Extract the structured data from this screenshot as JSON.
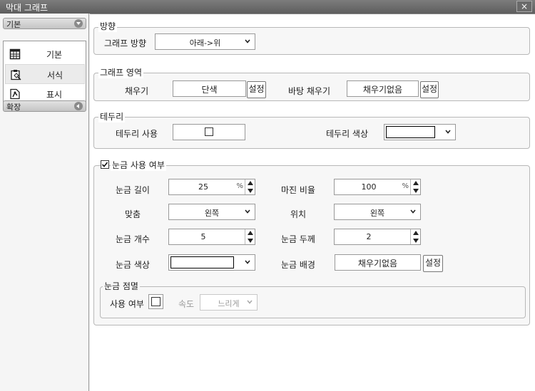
{
  "window": {
    "title": "막대 그래프",
    "close_glyph": "×"
  },
  "sidebar": {
    "basic_section": "기본",
    "extend_section": "확장",
    "items": [
      {
        "label": "기본",
        "icon": "table-icon"
      },
      {
        "label": "서식",
        "icon": "format-icon"
      },
      {
        "label": "표시",
        "icon": "display-icon"
      }
    ],
    "selected": "서식"
  },
  "direction": {
    "title": "방향",
    "label": "그래프 방향",
    "value": "아래->위"
  },
  "graph_area": {
    "title": "그래프 영역",
    "fill_label": "채우기",
    "fill_value": "단색",
    "fill_button": "설정",
    "bg_fill_label": "바탕 채우기",
    "bg_fill_value": "채우기없음",
    "bg_fill_button": "설정"
  },
  "border": {
    "title": "테두리",
    "use_label": "테두리 사용",
    "use_checked": false,
    "color_label": "테두리 색상",
    "color_value": "#ffffff"
  },
  "ticks": {
    "title": "눈금 사용 여부",
    "enabled": true,
    "length_label": "눈금 길이",
    "length_value": "25",
    "length_unit": "%",
    "margin_label": "마진 비율",
    "margin_value": "100",
    "margin_unit": "%",
    "align_label": "맞춤",
    "align_value": "왼쪽",
    "position_label": "위치",
    "position_value": "왼쪽",
    "count_label": "눈금 개수",
    "count_value": "5",
    "thickness_label": "눈금 두께",
    "thickness_value": "2",
    "color_label": "눈금 색상",
    "color_value": "#ffffff",
    "bg_label": "눈금 배경",
    "bg_value": "채우기없음",
    "bg_button": "설정"
  },
  "blink": {
    "title": "눈금 점멸",
    "use_label": "사용 여부",
    "use_checked": false,
    "speed_label": "속도",
    "speed_value": "느리게"
  }
}
